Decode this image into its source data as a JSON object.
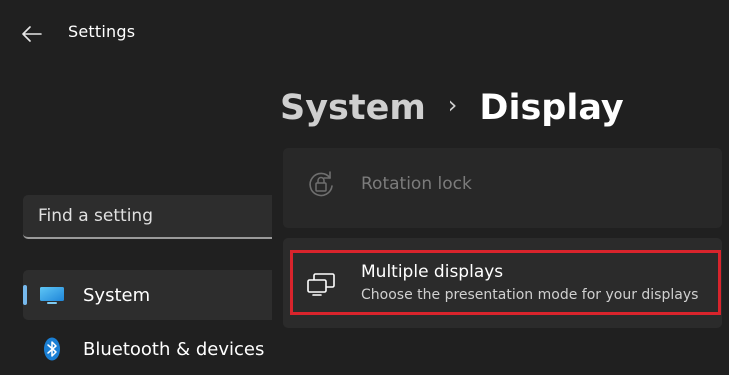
{
  "window": {
    "title": "Settings",
    "back_icon": "back-arrow-icon"
  },
  "search": {
    "placeholder": "Find a setting",
    "value": ""
  },
  "sidebar": {
    "items": [
      {
        "label": "System",
        "icon": "monitor-icon",
        "selected": true
      },
      {
        "label": "Bluetooth & devices",
        "icon": "bluetooth-icon",
        "selected": false
      }
    ]
  },
  "breadcrumb": {
    "parent": "System",
    "separator": "›",
    "current": "Display"
  },
  "settings": {
    "rotation_lock": {
      "title": "Rotation lock",
      "icon": "rotation-lock-icon",
      "enabled": false
    },
    "multiple_displays": {
      "title": "Multiple displays",
      "subtitle": "Choose the presentation mode for your displays",
      "icon": "multiple-displays-icon",
      "highlighted": true
    }
  },
  "colors": {
    "background": "#202020",
    "card": "#2b2b2b",
    "accent": "#76b9ed",
    "highlight": "#d8242c"
  }
}
